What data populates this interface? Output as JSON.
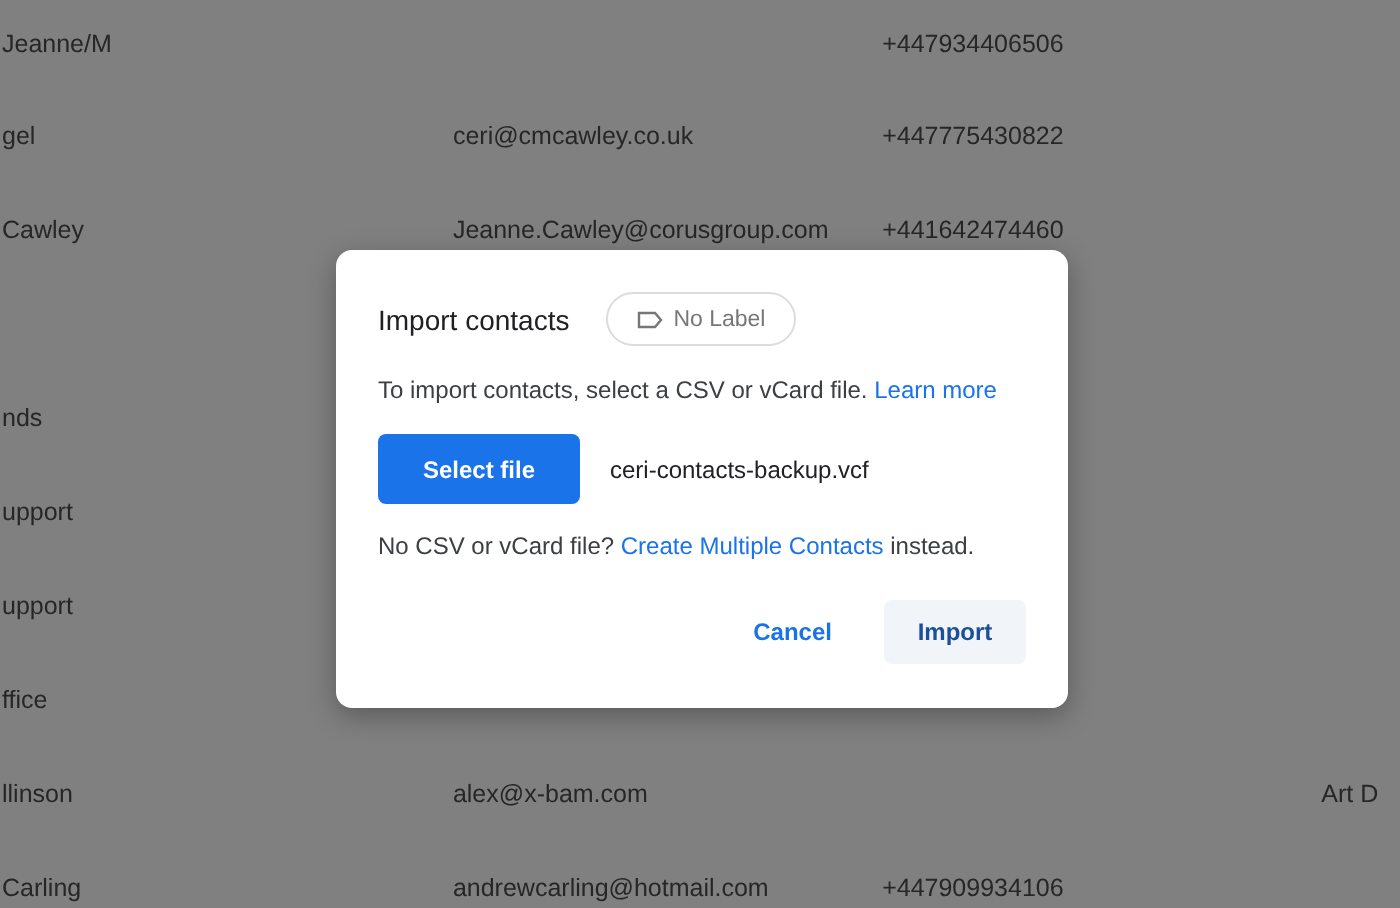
{
  "contacts": {
    "rows": [
      {
        "name": "Jeanne/M",
        "phone": "+447934406506"
      },
      {
        "name": "gel",
        "email": "ceri@cmcawley.co.uk",
        "phone": "+447775430822"
      },
      {
        "name": "Cawley",
        "email": "Jeanne.Cawley@corusgroup.com",
        "phone": "+441642474460"
      },
      {},
      {
        "name": "nds"
      },
      {
        "name": "upport"
      },
      {
        "name": "upport"
      },
      {
        "name": "ffice"
      },
      {
        "name": "llinson",
        "email": "alex@x-bam.com",
        "column_4": "Art D"
      },
      {
        "name": "Carling",
        "email": "andrewcarling@hotmail.com",
        "phone": "+447909934106"
      }
    ]
  },
  "dialog": {
    "title": "Import contacts",
    "label_chip": "No Label",
    "description": "To import contacts, select a CSV or vCard file.",
    "learn_more_link": "Learn more",
    "select_button": "Select file",
    "file_name": "ceri-contacts-backup.vcf",
    "alt_prefix": "No CSV or vCard file?",
    "alt_link": "Create Multiple Contacts",
    "alt_suffix": "instead.",
    "buttons": [
      {
        "label": "Cancel",
        "kind": "text"
      },
      {
        "label": "Import",
        "kind": "tonal"
      }
    ]
  }
}
